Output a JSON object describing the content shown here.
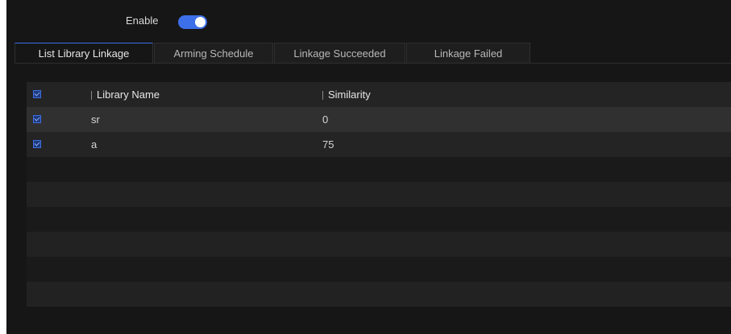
{
  "enable": {
    "label": "Enable",
    "state": "on",
    "accent_color": "#3d6fe8"
  },
  "tabs": [
    {
      "label": "List Library Linkage",
      "active": true
    },
    {
      "label": "Arming Schedule",
      "active": false
    },
    {
      "label": "Linkage Succeeded",
      "active": false
    },
    {
      "label": "Linkage Failed",
      "active": false
    }
  ],
  "table": {
    "columns": [
      "Library Name",
      "Similarity"
    ],
    "select_all_checked": true,
    "rows": [
      {
        "checked": true,
        "library_name": "sr",
        "similarity": "0"
      },
      {
        "checked": true,
        "library_name": "a",
        "similarity": "75"
      }
    ]
  }
}
